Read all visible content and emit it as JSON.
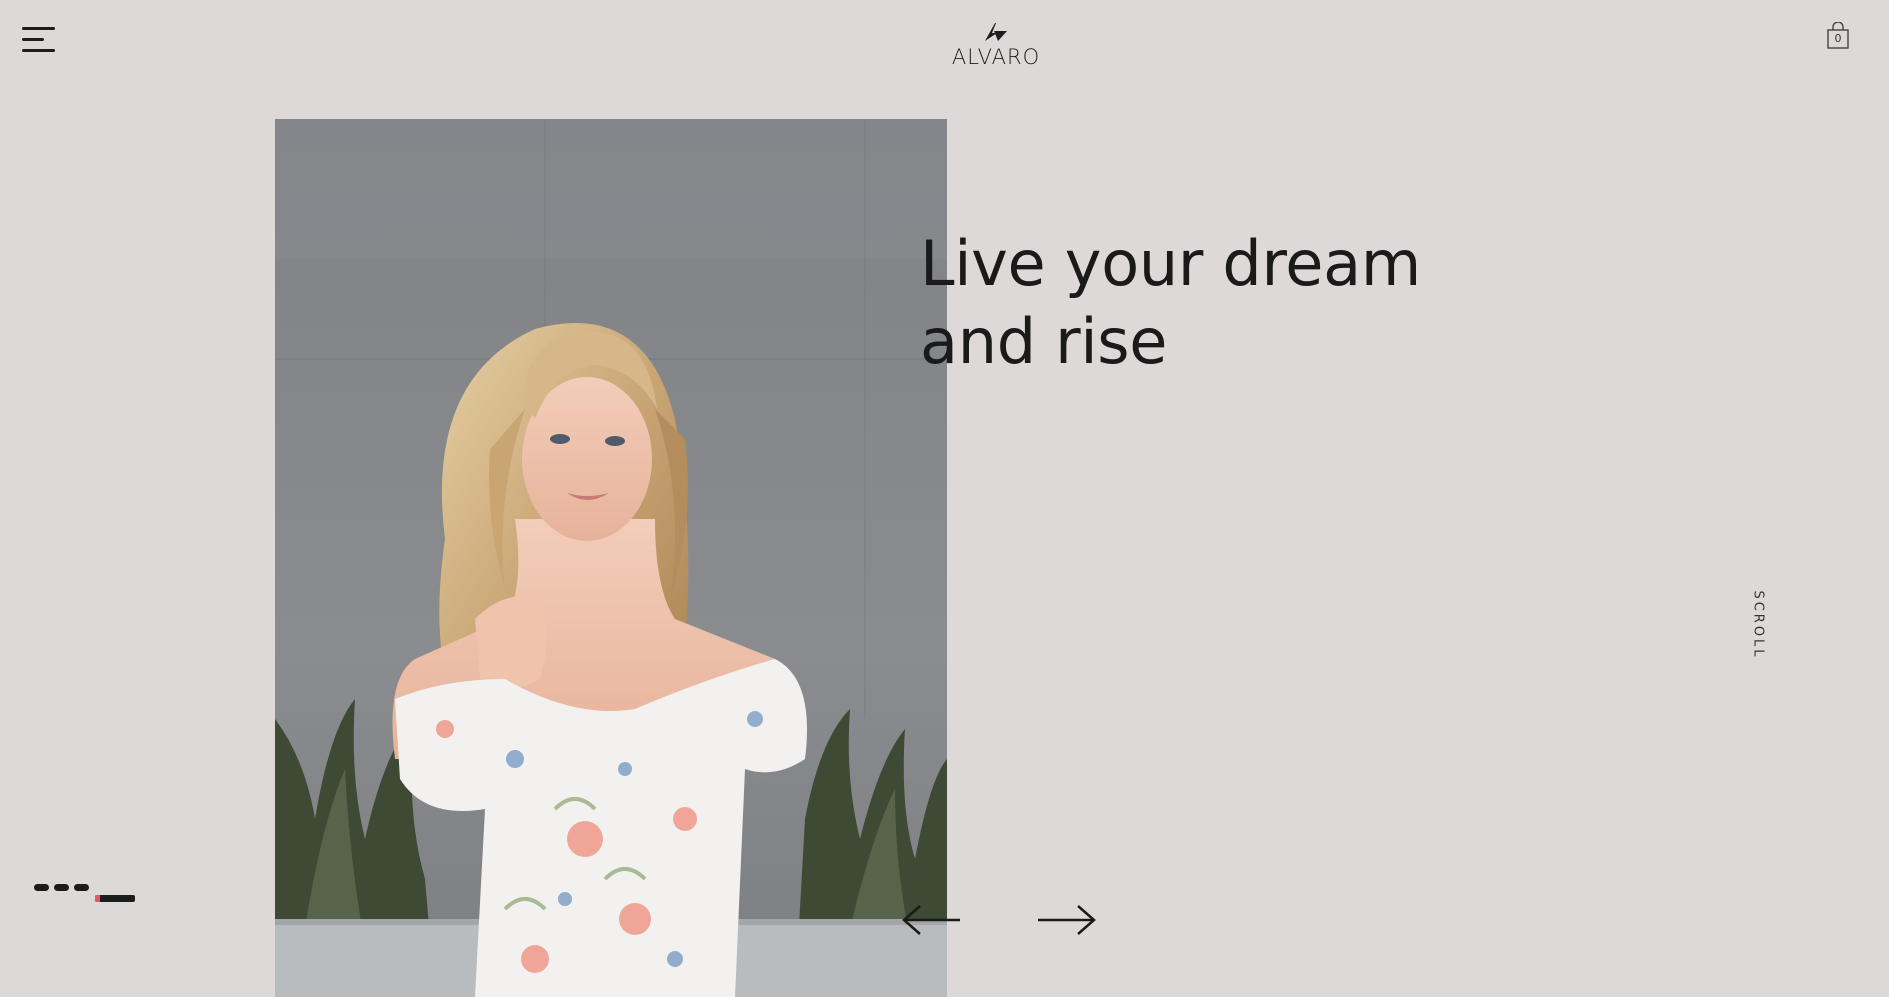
{
  "header": {
    "brand": "ALVARO",
    "menu_icon": "hamburger-menu-icon",
    "logo_icon": "alvaro-logo-mark-icon",
    "cart_icon": "shopping-bag-icon",
    "cart_count": "0"
  },
  "hero": {
    "headline_line1": "Live your dream",
    "headline_line2": "and rise",
    "image_description": "model-in-floral-dress-photo"
  },
  "scroll": {
    "label": "SCROLL"
  },
  "slider": {
    "total_slides": 4,
    "active_index": 4,
    "prev_icon": "arrow-left-icon",
    "next_icon": "arrow-right-icon",
    "accent_color": "#e8556b"
  },
  "colors": {
    "background": "#dcd9d8",
    "text": "#1a1a1a"
  }
}
